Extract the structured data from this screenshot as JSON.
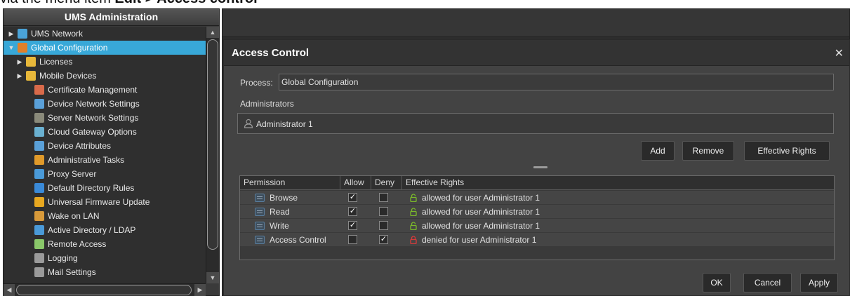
{
  "caption": {
    "prefix": "via the menu item ",
    "path": "Edit > Access control"
  },
  "left_panel": {
    "title": "UMS Administration",
    "tree": [
      {
        "label": "UMS Network",
        "arrow": "▶",
        "level": 0,
        "icon": "network-icon",
        "color": "#4aa3d8"
      },
      {
        "label": "Global Configuration",
        "arrow": "▼",
        "level": 0,
        "icon": "global-config-icon",
        "color": "#e0802a",
        "selected": true
      },
      {
        "label": "Licenses",
        "arrow": "▶",
        "level": 1,
        "icon": "folder-icon",
        "color": "#e8b83a"
      },
      {
        "label": "Mobile Devices",
        "arrow": "▶",
        "level": 1,
        "icon": "folder-icon",
        "color": "#e8b83a"
      },
      {
        "label": "Certificate Management",
        "arrow": "",
        "level": 2,
        "icon": "certificate-icon",
        "color": "#d86a4a"
      },
      {
        "label": "Device Network Settings",
        "arrow": "",
        "level": 2,
        "icon": "device-network-icon",
        "color": "#5aa0d8"
      },
      {
        "label": "Server Network Settings",
        "arrow": "",
        "level": 2,
        "icon": "server-network-icon",
        "color": "#8a8a7a"
      },
      {
        "label": "Cloud Gateway Options",
        "arrow": "",
        "level": 2,
        "icon": "cloud-gateway-icon",
        "color": "#6ab0d0"
      },
      {
        "label": "Device Attributes",
        "arrow": "",
        "level": 2,
        "icon": "device-attributes-icon",
        "color": "#5aa0d8"
      },
      {
        "label": "Administrative Tasks",
        "arrow": "",
        "level": 2,
        "icon": "admin-tasks-icon",
        "color": "#e09a2a"
      },
      {
        "label": "Proxy Server",
        "arrow": "",
        "level": 2,
        "icon": "proxy-server-icon",
        "color": "#4a9ad8"
      },
      {
        "label": "Default Directory Rules",
        "arrow": "",
        "level": 2,
        "icon": "directory-rules-icon",
        "color": "#3a8ad8"
      },
      {
        "label": "Universal Firmware Update",
        "arrow": "",
        "level": 2,
        "icon": "firmware-update-icon",
        "color": "#e8a820"
      },
      {
        "label": "Wake on LAN",
        "arrow": "",
        "level": 2,
        "icon": "wake-on-lan-icon",
        "color": "#d89a3a"
      },
      {
        "label": "Active Directory / LDAP",
        "arrow": "",
        "level": 2,
        "icon": "ldap-icon",
        "color": "#4a9ad8"
      },
      {
        "label": "Remote Access",
        "arrow": "",
        "level": 2,
        "icon": "remote-access-icon",
        "color": "#8ac86a"
      },
      {
        "label": "Logging",
        "arrow": "",
        "level": 2,
        "icon": "logging-icon",
        "color": "#9a9a9a"
      },
      {
        "label": "Mail Settings",
        "arrow": "",
        "level": 2,
        "icon": "mail-icon",
        "color": "#9a9a9a"
      }
    ]
  },
  "dialog": {
    "title": "Access Control",
    "close_symbol": "✕",
    "process_label": "Process:",
    "process_value": "Global Configuration",
    "administrators_label": "Administrators",
    "administrators": [
      "Administrator 1"
    ],
    "buttons": {
      "add": "Add",
      "remove": "Remove",
      "effective_rights": "Effective Rights",
      "ok": "OK",
      "cancel": "Cancel",
      "apply": "Apply"
    },
    "table": {
      "headers": [
        "Permission",
        "Allow",
        "Deny",
        "Effective Rights"
      ],
      "rows": [
        {
          "permission": "Browse",
          "allow": true,
          "deny": false,
          "effective": "allowed for user Administrator 1",
          "lock_color": "#7ab82a"
        },
        {
          "permission": "Read",
          "allow": true,
          "deny": false,
          "effective": "allowed for user Administrator 1",
          "lock_color": "#7ab82a"
        },
        {
          "permission": "Write",
          "allow": true,
          "deny": false,
          "effective": "allowed for user Administrator 1",
          "lock_color": "#7ab82a"
        },
        {
          "permission": "Access Control",
          "allow": false,
          "deny": true,
          "effective": "denied for user Administrator 1",
          "lock_color": "#d83a3a"
        }
      ]
    }
  },
  "colors": {
    "selection": "#38a8d8",
    "panel_bg": "#2f2f2f",
    "dialog_bg": "#434343"
  }
}
